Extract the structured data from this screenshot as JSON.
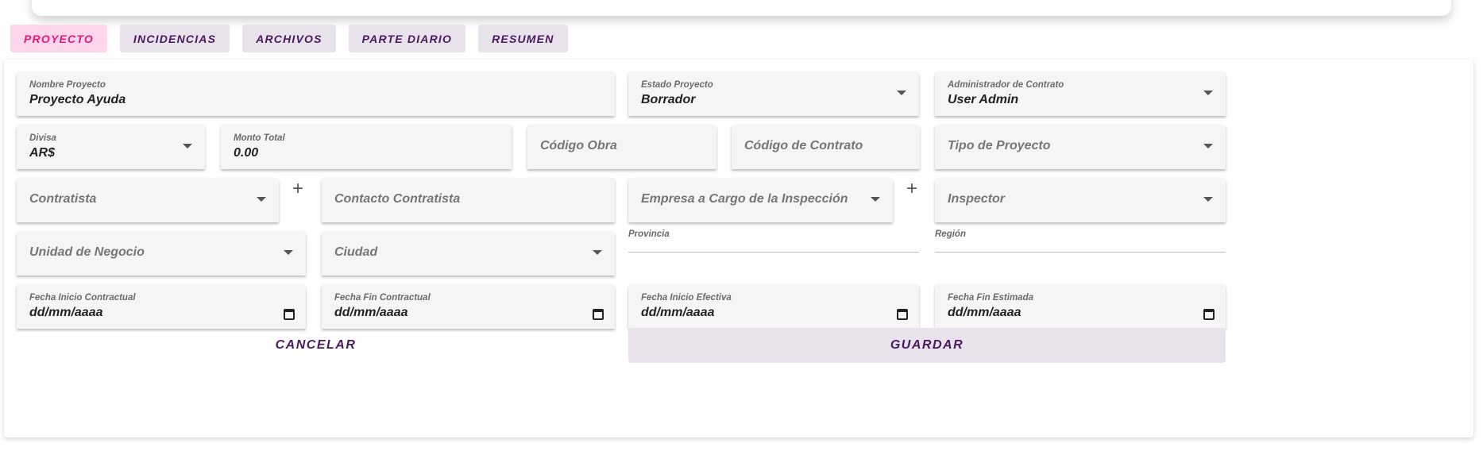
{
  "tabs": [
    {
      "label": "PROYECTO",
      "active": true
    },
    {
      "label": "INCIDENCIAS",
      "active": false
    },
    {
      "label": "ARCHIVOS",
      "active": false
    },
    {
      "label": "PARTE DIARIO",
      "active": false
    },
    {
      "label": "RESUMEN",
      "active": false
    }
  ],
  "form": {
    "nombre_proyecto": {
      "label": "Nombre Proyecto",
      "value": "Proyecto Ayuda"
    },
    "estado_proyecto": {
      "label": "Estado Proyecto",
      "value": "Borrador"
    },
    "administrador": {
      "label": "Administrador de Contrato",
      "value": "User Admin"
    },
    "divisa": {
      "label": "Divisa",
      "value": "AR$"
    },
    "monto_total": {
      "label": "Monto Total",
      "value": "0.00"
    },
    "codigo_obra": {
      "placeholder": "Código Obra"
    },
    "codigo_contrato": {
      "placeholder": "Código de Contrato"
    },
    "tipo_proyecto": {
      "placeholder": "Tipo de Proyecto"
    },
    "contratista": {
      "placeholder": "Contratista"
    },
    "contacto_contratista": {
      "placeholder": "Contacto Contratista"
    },
    "empresa_inspeccion": {
      "placeholder": "Empresa a Cargo de la Inspección"
    },
    "inspector": {
      "placeholder": "Inspector"
    },
    "unidad_negocio": {
      "placeholder": "Unidad de Negocio"
    },
    "ciudad": {
      "placeholder": "Ciudad"
    },
    "provincia": {
      "label": "Provincia"
    },
    "region": {
      "label": "Región"
    },
    "fecha_inicio_contractual": {
      "label": "Fecha Inicio Contractual",
      "value": "dd/mm/aaaa"
    },
    "fecha_fin_contractual": {
      "label": "Fecha Fin Contractual",
      "value": "dd/mm/aaaa"
    },
    "fecha_inicio_efectiva": {
      "label": "Fecha Inicio Efectiva",
      "value": "dd/mm/aaaa"
    },
    "fecha_fin_estimada": {
      "label": "Fecha Fin Estimada",
      "value": "dd/mm/aaaa"
    }
  },
  "actions": {
    "cancel": "CANCELAR",
    "save": "GUARDAR"
  },
  "colors": {
    "accent": "#e6197a",
    "primary": "#4a1a5e",
    "tab_bg": "#e8e2ea",
    "tab_active_bg": "#fcd6ea"
  }
}
